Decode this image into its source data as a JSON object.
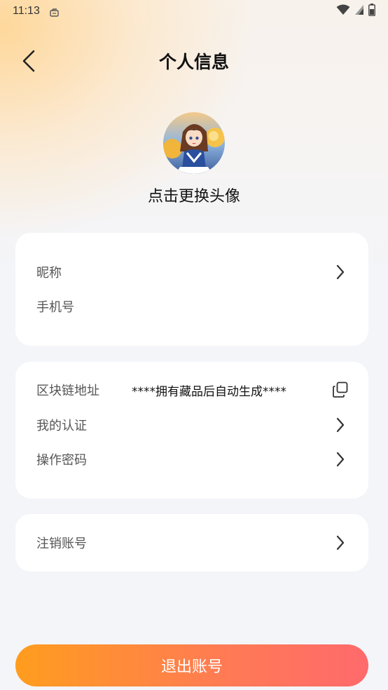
{
  "status_bar": {
    "time": "11:13",
    "icons": [
      "notification-icon",
      "wifi-icon",
      "signal-icon",
      "battery-icon"
    ]
  },
  "header": {
    "back_icon": "chevron-left-icon",
    "title": "个人信息"
  },
  "avatar": {
    "hint": "点击更换头像"
  },
  "card_basic": {
    "rows": [
      {
        "label": "昵称",
        "action_icon": "chevron-right-icon"
      },
      {
        "label": "手机号"
      }
    ]
  },
  "card_chain": {
    "rows": [
      {
        "label": "区块链地址",
        "value": "****拥有藏品后自动生成****",
        "action_icon": "copy-icon"
      },
      {
        "label": "我的认证",
        "action_icon": "chevron-right-icon"
      },
      {
        "label": "操作密码",
        "action_icon": "chevron-right-icon"
      }
    ]
  },
  "card_account": {
    "rows": [
      {
        "label": "注销账号",
        "action_icon": "chevron-right-icon"
      }
    ]
  },
  "logout": {
    "label": "退出账号"
  },
  "colors": {
    "background": "#f4f5f9",
    "card": "#ffffff",
    "button_gradient_start": "#ff9d1e",
    "button_gradient_end": "#ff6a6c"
  }
}
